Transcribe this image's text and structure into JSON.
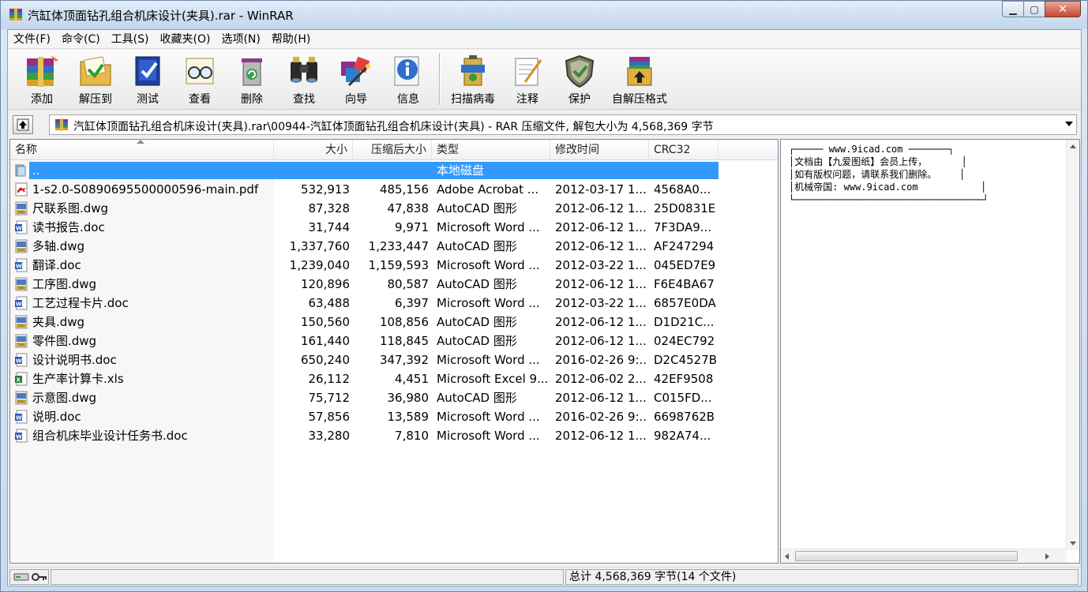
{
  "window": {
    "title": "汽缸体顶面钻孔组合机床设计(夹具).rar - WinRAR",
    "controls": {
      "minimize": "▁",
      "maximize": "▢",
      "close": "✕"
    }
  },
  "menu": [
    "文件(F)",
    "命令(C)",
    "工具(S)",
    "收藏夹(O)",
    "选项(N)",
    "帮助(H)"
  ],
  "toolbar": {
    "add": "添加",
    "extract": "解压到",
    "test": "测试",
    "view": "查看",
    "delete": "删除",
    "find": "查找",
    "wizard": "向导",
    "info": "信息",
    "scan": "扫描病毒",
    "comment": "注释",
    "protect": "保护",
    "sfx": "自解压格式"
  },
  "path": {
    "text": "汽缸体顶面钻孔组合机床设计(夹具).rar\\00944-汽缸体顶面钻孔组合机床设计(夹具) - RAR 压缩文件, 解包大小为 4,568,369 字节"
  },
  "columns": {
    "name": "名称",
    "size": "大小",
    "packed": "压缩后大小",
    "type": "类型",
    "modified": "修改时间",
    "crc": "CRC32"
  },
  "files": [
    {
      "icon": "folder-up-icon",
      "name": "..",
      "size": "",
      "packed": "",
      "type": "本地磁盘",
      "modified": "",
      "crc": "",
      "selected": true
    },
    {
      "icon": "pdf-file-icon",
      "name": "1-s2.0-S0890695500000596-main.pdf",
      "size": "532,913",
      "packed": "485,156",
      "type": "Adobe Acrobat ...",
      "modified": "2012-03-17 1...",
      "crc": "4568A0..."
    },
    {
      "icon": "dwg-file-icon",
      "name": "尺联系图.dwg",
      "size": "87,328",
      "packed": "47,838",
      "type": "AutoCAD 图形",
      "modified": "2012-06-12 1...",
      "crc": "25D0831E"
    },
    {
      "icon": "doc-file-icon",
      "name": "读书报告.doc",
      "size": "31,744",
      "packed": "9,971",
      "type": "Microsoft Word ...",
      "modified": "2012-06-12 1...",
      "crc": "7F3DA9..."
    },
    {
      "icon": "dwg-file-icon",
      "name": "多轴.dwg",
      "size": "1,337,760",
      "packed": "1,233,447",
      "type": "AutoCAD 图形",
      "modified": "2012-06-12 1...",
      "crc": "AF247294"
    },
    {
      "icon": "doc-file-icon",
      "name": "翻译.doc",
      "size": "1,239,040",
      "packed": "1,159,593",
      "type": "Microsoft Word ...",
      "modified": "2012-03-22 1...",
      "crc": "045ED7E9"
    },
    {
      "icon": "dwg-file-icon",
      "name": "工序图.dwg",
      "size": "120,896",
      "packed": "80,587",
      "type": "AutoCAD 图形",
      "modified": "2012-06-12 1...",
      "crc": "F6E4BA67"
    },
    {
      "icon": "doc-file-icon",
      "name": "工艺过程卡片.doc",
      "size": "63,488",
      "packed": "6,397",
      "type": "Microsoft Word ...",
      "modified": "2012-03-22 1...",
      "crc": "6857E0DA"
    },
    {
      "icon": "dwg-file-icon",
      "name": "夹具.dwg",
      "size": "150,560",
      "packed": "108,856",
      "type": "AutoCAD 图形",
      "modified": "2012-06-12 1...",
      "crc": "D1D21C..."
    },
    {
      "icon": "dwg-file-icon",
      "name": "零件图.dwg",
      "size": "161,440",
      "packed": "118,845",
      "type": "AutoCAD 图形",
      "modified": "2012-06-12 1...",
      "crc": "024EC792"
    },
    {
      "icon": "doc-file-icon",
      "name": "设计说明书.doc",
      "size": "650,240",
      "packed": "347,392",
      "type": "Microsoft Word ...",
      "modified": "2016-02-26 9:...",
      "crc": "D2C4527B"
    },
    {
      "icon": "xls-file-icon",
      "name": "生产率计算卡.xls",
      "size": "26,112",
      "packed": "4,451",
      "type": "Microsoft Excel 9...",
      "modified": "2012-06-02 2...",
      "crc": "42EF9508"
    },
    {
      "icon": "dwg-file-icon",
      "name": "示意图.dwg",
      "size": "75,712",
      "packed": "36,980",
      "type": "AutoCAD 图形",
      "modified": "2012-06-12 1...",
      "crc": "C015FD..."
    },
    {
      "icon": "doc-file-icon",
      "name": "说明.doc",
      "size": "57,856",
      "packed": "13,589",
      "type": "Microsoft Word ...",
      "modified": "2016-02-26 9:...",
      "crc": "6698762B"
    },
    {
      "icon": "doc-file-icon",
      "name": "组合机床毕业设计任务书.doc",
      "size": "33,280",
      "packed": "7,810",
      "type": "Microsoft Word ...",
      "modified": "2012-06-12 1...",
      "crc": "982A74..."
    }
  ],
  "comment": {
    "lines": [
      "┌───── www.9icad.com ───────┐",
      "│文档由【九爱图纸】会员上传，      │",
      "│如有版权问题，请联系我们删除。    │",
      "│机械帝国: www.9icad.com           │",
      "└─────────────────────────────────┘"
    ]
  },
  "status": {
    "total": "总计 4,568,369 字节(14 个文件)"
  }
}
